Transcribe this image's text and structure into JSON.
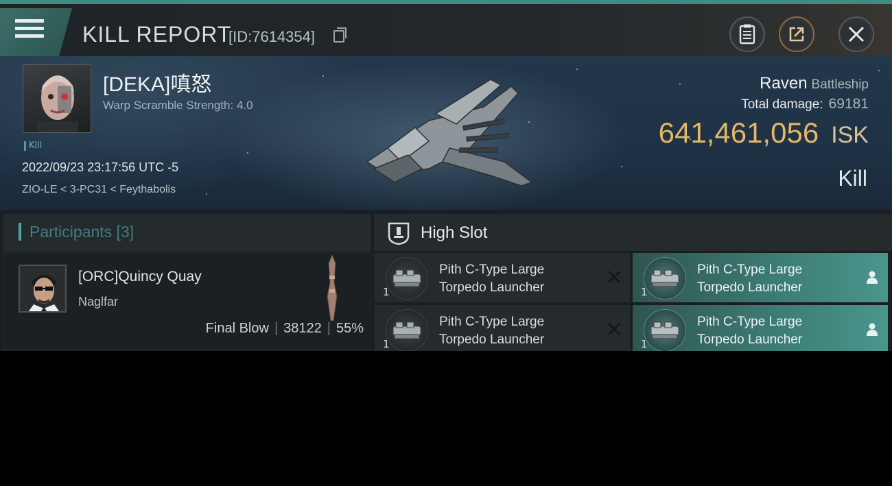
{
  "header": {
    "title": "KILL REPORT",
    "report_id": "[ID:7614354]",
    "icons": [
      "menu-icon",
      "copy-icon",
      "clipboard-icon",
      "share-icon",
      "close-icon"
    ]
  },
  "victim": {
    "name": "[DEKA]嗔怒",
    "warp_scramble": "Warp Scramble Strength: 4.0",
    "tag": "Kill",
    "datetime": "2022/09/23 23:17:56 UTC -5",
    "location": "ZIO-LE < 3-PC31 < Feythabolis"
  },
  "ship": {
    "name": "Raven",
    "class": "Battleship",
    "damage_label": "Total damage:",
    "damage_value": "69181",
    "isk_value": "641,461,056",
    "isk_unit": "ISK",
    "result": "Kill"
  },
  "participants": {
    "title": "Participants [3]",
    "items": [
      {
        "name": "[ORC]Quincy Quay",
        "ship": "Naglfar",
        "label": "Final Blow",
        "damage": "38122",
        "percent": "55%"
      }
    ]
  },
  "high_slot": {
    "title": "High Slot",
    "modules": [
      {
        "name_line1": "Pith C-Type Large",
        "name_line2": "Torpedo Launcher",
        "qty": "1",
        "status": "destroyed"
      },
      {
        "name_line1": "Pith C-Type Large",
        "name_line2": "Torpedo Launcher",
        "qty": "1",
        "status": "dropped"
      },
      {
        "name_line1": "Pith C-Type Large",
        "name_line2": "Torpedo Launcher",
        "qty": "1",
        "status": "destroyed"
      },
      {
        "name_line1": "Pith C-Type Large",
        "name_line2": "Torpedo Launcher",
        "qty": "1",
        "status": "dropped"
      }
    ]
  },
  "colors": {
    "accent_teal": "#3f8c84",
    "isk_gold": "#e3b76a",
    "highlight_module": "#3d7f77"
  }
}
